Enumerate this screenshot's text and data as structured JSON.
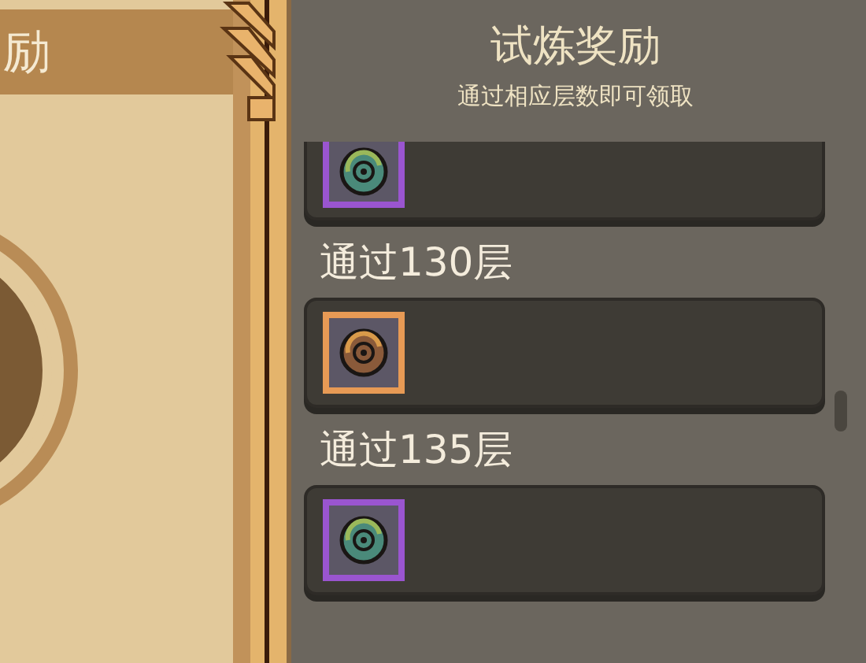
{
  "left_panel": {
    "title": "励"
  },
  "rewards_panel": {
    "title": "试炼奖励",
    "subtitle": "通过相应层数即可领取"
  },
  "rewards": [
    {
      "color": "#9a55d0"
    },
    {
      "label": "通过130层",
      "color": "#e79a55"
    },
    {
      "label": "通过135层",
      "color": "#9a55d0"
    }
  ]
}
